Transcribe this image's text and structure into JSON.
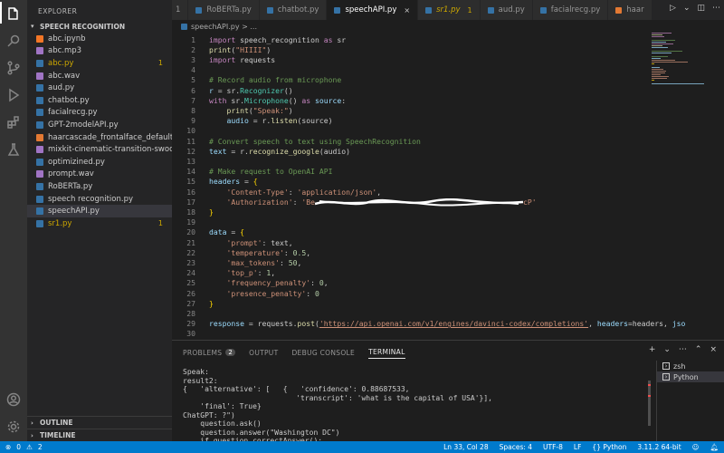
{
  "sidebar": {
    "title": "EXPLORER",
    "folder": "SPEECH RECOGNITION",
    "files": [
      {
        "name": "abc.ipynb",
        "color": "#f37626"
      },
      {
        "name": "abc.mp3",
        "color": "#a074c4"
      },
      {
        "name": "abc.py",
        "color": "#3572A5",
        "warn": true,
        "badge": "1"
      },
      {
        "name": "abc.wav",
        "color": "#a074c4"
      },
      {
        "name": "aud.py",
        "color": "#3572A5"
      },
      {
        "name": "chatbot.py",
        "color": "#3572A5"
      },
      {
        "name": "facialrecg.py",
        "color": "#3572A5"
      },
      {
        "name": "GPT-2modelAPI.py",
        "color": "#3572A5"
      },
      {
        "name": "haarcascade_frontalface_default.x...",
        "color": "#e37933"
      },
      {
        "name": "mixkit-cinematic-transition-swoos...",
        "color": "#a074c4"
      },
      {
        "name": "optimizined.py",
        "color": "#3572A5"
      },
      {
        "name": "prompt.wav",
        "color": "#a074c4"
      },
      {
        "name": "RoBERTa.py",
        "color": "#3572A5"
      },
      {
        "name": "speech recognition.py",
        "color": "#3572A5"
      },
      {
        "name": "speechAPI.py",
        "color": "#3572A5",
        "selected": true
      },
      {
        "name": "sr1.py",
        "color": "#3572A5",
        "warn": true,
        "badge": "1"
      }
    ],
    "outline": "OUTLINE",
    "timeline": "TIMELINE"
  },
  "tabs": [
    {
      "label": "1",
      "color": "#3572A5"
    },
    {
      "label": "RoBERTa.py",
      "color": "#3572A5"
    },
    {
      "label": "chatbot.py",
      "color": "#3572A5"
    },
    {
      "label": "speechAPI.py",
      "color": "#3572A5",
      "active": true,
      "close": "×"
    },
    {
      "label": "sr1.py",
      "color": "#3572A5",
      "warn": true,
      "badge": "1"
    },
    {
      "label": "aud.py",
      "color": "#3572A5"
    },
    {
      "label": "facialrecg.py",
      "color": "#3572A5"
    },
    {
      "label": "haar",
      "color": "#e37933"
    }
  ],
  "breadcrumb": "speechAPI.py > ...",
  "code": [
    {
      "n": "1",
      "html": "<span class='kw'>import</span> speech_recognition <span class='kw'>as</span> sr"
    },
    {
      "n": "2",
      "html": "<span class='fn'>print</span>(<span class='str'>\"HIIII\"</span>)"
    },
    {
      "n": "3",
      "html": "<span class='kw'>import</span> requests"
    },
    {
      "n": "4",
      "html": ""
    },
    {
      "n": "5",
      "html": "<span class='com'># Record audio from microphone</span>"
    },
    {
      "n": "6",
      "html": "<span class='var'>r</span> = sr.<span class='cls'>Recognizer</span>()"
    },
    {
      "n": "7",
      "html": "<span class='kw'>with</span> sr.<span class='cls'>Microphone</span>() <span class='kw'>as</span> <span class='var'>source</span>:"
    },
    {
      "n": "8",
      "html": "    <span class='fn'>print</span>(<span class='str'>\"Speak:\"</span>)"
    },
    {
      "n": "9",
      "html": "    <span class='var'>audio</span> = r.<span class='fn'>listen</span>(source)"
    },
    {
      "n": "10",
      "html": ""
    },
    {
      "n": "11",
      "html": "<span class='com'># Convert speech to text using SpeechRecognition</span>"
    },
    {
      "n": "12",
      "html": "<span class='var'>text</span> = r.<span class='fn'>recognize_google</span>(audio)"
    },
    {
      "n": "13",
      "html": ""
    },
    {
      "n": "14",
      "html": "<span class='com'># Make request to OpenAI API</span>"
    },
    {
      "n": "15",
      "html": "<span class='var'>headers</span> = <span class='br'>{</span>"
    },
    {
      "n": "16",
      "html": "    <span class='str'>'Content-Type'</span>: <span class='str'>'application/json'</span>,"
    },
    {
      "n": "17",
      "html": "    <span class='str'>'Authorization'</span>: <span class='str'>'Be</span><span class='redact'></span><span class='str'>cP'</span>"
    },
    {
      "n": "18",
      "html": "<span class='br'>}</span>"
    },
    {
      "n": "19",
      "html": ""
    },
    {
      "n": "20",
      "html": "<span class='var'>data</span> = <span class='br'>{</span>"
    },
    {
      "n": "21",
      "html": "    <span class='str'>'prompt'</span>: text,"
    },
    {
      "n": "22",
      "html": "    <span class='str'>'temperature'</span>: <span class='num'>0.5</span>,"
    },
    {
      "n": "23",
      "html": "    <span class='str'>'max_tokens'</span>: <span class='num'>50</span>,"
    },
    {
      "n": "24",
      "html": "    <span class='str'>'top_p'</span>: <span class='num'>1</span>,"
    },
    {
      "n": "25",
      "html": "    <span class='str'>'frequency_penalty'</span>: <span class='num'>0</span>,"
    },
    {
      "n": "26",
      "html": "    <span class='str'>'presence_penalty'</span>: <span class='num'>0</span>"
    },
    {
      "n": "27",
      "html": "<span class='br'>}</span>"
    },
    {
      "n": "28",
      "html": ""
    },
    {
      "n": "29",
      "html": "<span class='var'>response</span> = requests.<span class='fn'>post</span>(<span class='link'>'https://api.openai.com/v1/engines/davinci-codex/completions'</span>, <span class='var'>headers</span>=headers, <span class='var'>jso</span>"
    },
    {
      "n": "30",
      "html": ""
    }
  ],
  "panel": {
    "tabs": [
      {
        "label": "PROBLEMS",
        "badge": "2"
      },
      {
        "label": "OUTPUT"
      },
      {
        "label": "DEBUG CONSOLE"
      },
      {
        "label": "TERMINAL",
        "active": true
      }
    ],
    "terminal_lines": [
      "Speak:",
      "result2:",
      "{   'alternative': [   {   'confidence': 0.88687533,",
      "                          'transcript': 'what is the capital of USA'}],",
      "    'final': True}",
      "ChatGPT: ?\")",
      "    question.ask()",
      "    question.answer(\"Washington DC\")",
      "    if question.correctAnswer():"
    ],
    "terminals": [
      {
        "label": "zsh"
      },
      {
        "label": "Python",
        "selected": true
      }
    ]
  },
  "status": {
    "errors": "0",
    "warnings": "2",
    "position": "Ln 33, Col 28",
    "spaces": "Spaces: 4",
    "encoding": "UTF-8",
    "eol": "LF",
    "language": "Python",
    "interpreter": "3.11.2 64-bit"
  }
}
